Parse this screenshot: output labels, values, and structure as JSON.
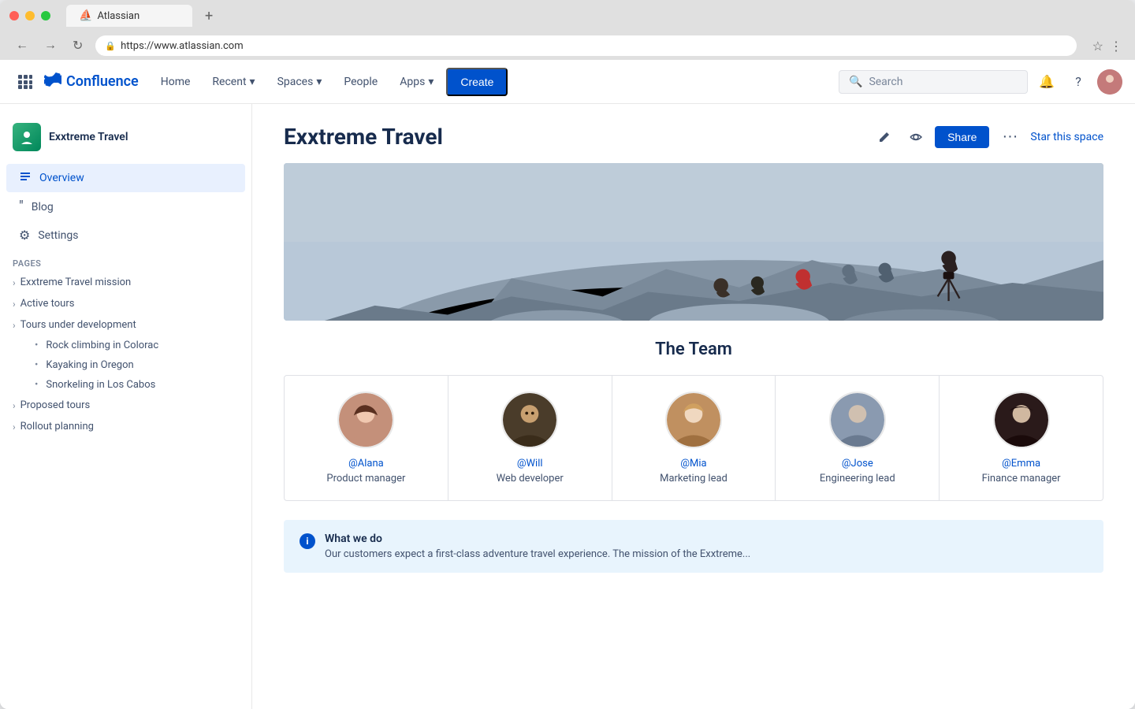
{
  "browser": {
    "tab_title": "Atlassian",
    "url": "https://www.atlassian.com",
    "tab_plus": "+",
    "back_btn": "←",
    "forward_btn": "→",
    "refresh_btn": "↻"
  },
  "topnav": {
    "logo_text": "Confluence",
    "nav_items": [
      {
        "label": "Home",
        "has_dropdown": false
      },
      {
        "label": "Recent",
        "has_dropdown": true
      },
      {
        "label": "Spaces",
        "has_dropdown": true
      },
      {
        "label": "People",
        "has_dropdown": false
      },
      {
        "label": "Apps",
        "has_dropdown": true
      }
    ],
    "create_btn": "Create",
    "search_placeholder": "Search"
  },
  "sidebar": {
    "space_name": "Exxtreme Travel",
    "nav_items": [
      {
        "icon": "≡",
        "label": "Overview",
        "active": true
      },
      {
        "icon": "❝",
        "label": "Blog",
        "active": false
      },
      {
        "icon": "⚙",
        "label": "Settings",
        "active": false
      }
    ],
    "pages_section": "PAGES",
    "pages": [
      {
        "label": "Exxtreme Travel mission",
        "expanded": false,
        "sub_items": []
      },
      {
        "label": "Active tours",
        "expanded": false,
        "sub_items": []
      },
      {
        "label": "Tours under development",
        "expanded": true,
        "sub_items": [
          "Rock climbing in Colorac",
          "Kayaking in Oregon",
          "Snorkeling in Los Cabos"
        ]
      },
      {
        "label": "Proposed tours",
        "expanded": false,
        "sub_items": []
      },
      {
        "label": "Rollout planning",
        "expanded": false,
        "sub_items": []
      }
    ]
  },
  "page": {
    "title": "Exxtreme Travel",
    "share_btn": "Share",
    "star_btn": "Star this space",
    "team_section_title": "The Team",
    "team_members": [
      {
        "handle": "@Alana",
        "role": "Product manager",
        "color": "#c4907a"
      },
      {
        "handle": "@Will",
        "role": "Web developer",
        "color": "#3a2c1a"
      },
      {
        "handle": "@Mia",
        "role": "Marketing lead",
        "color": "#c4a882"
      },
      {
        "handle": "@Jose",
        "role": "Engineering lead",
        "color": "#8a9ab0"
      },
      {
        "handle": "@Emma",
        "role": "Finance manager",
        "color": "#2a1a1a"
      }
    ],
    "info_title": "What we do",
    "info_text": "Our customers expect a first-class adventure travel experience. The mission of the Exxtreme...",
    "colors": {
      "accent": "#0052cc",
      "info_bg": "#e8f4fd"
    }
  }
}
